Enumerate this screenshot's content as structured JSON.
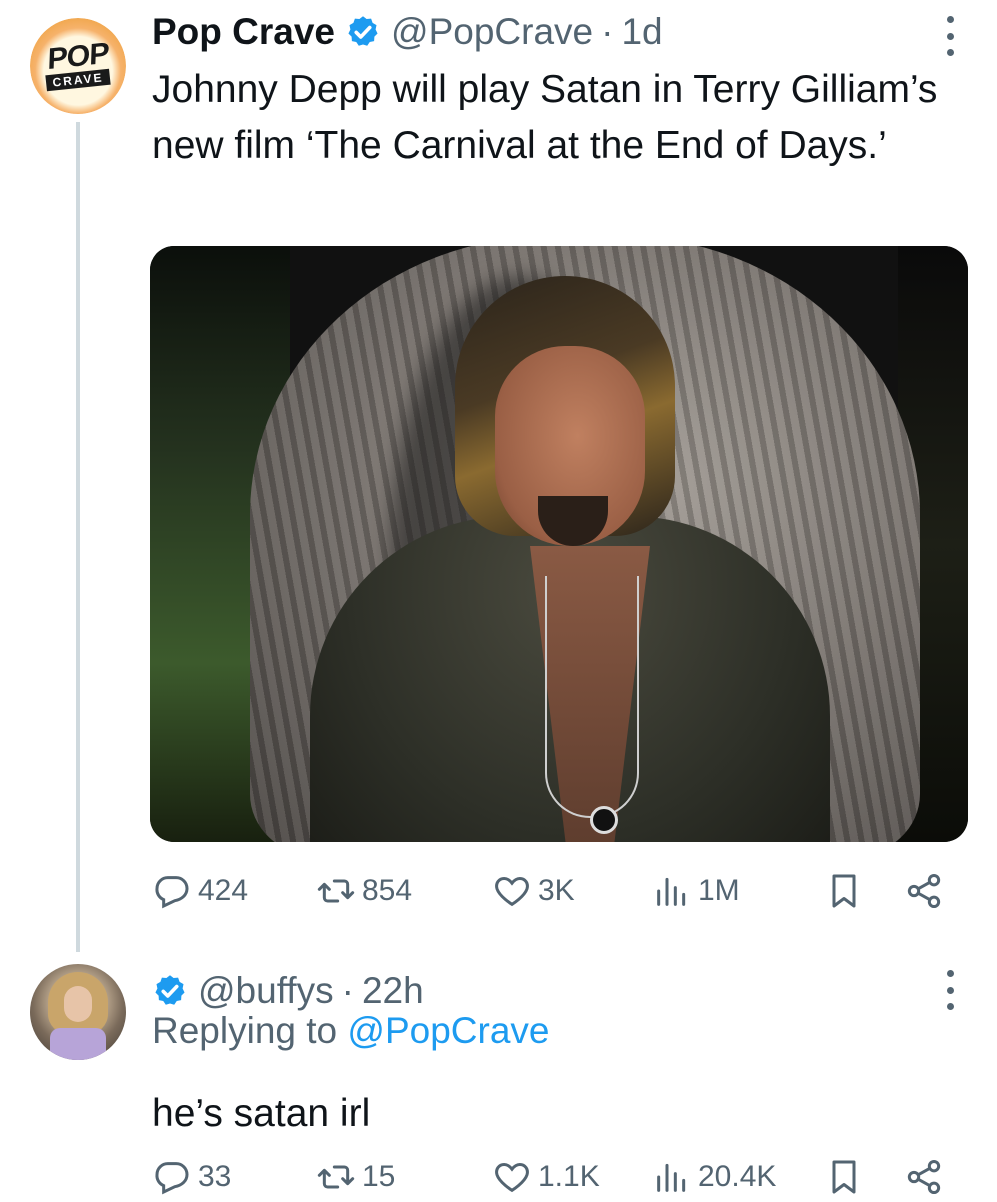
{
  "tweet": {
    "display_name": "Pop Crave",
    "handle": "@PopCrave",
    "separator": "·",
    "time": "1d",
    "text": "Johnny Depp will play Satan in Terry Gilliam’s new film ‘The Carnival at the End of Days.’",
    "avatar_logo_top": "POP",
    "avatar_logo_bottom": "CRAVE",
    "media_icon": "photo-of-johnny-depp",
    "stats": {
      "replies": "424",
      "retweets": "854",
      "likes": "3K",
      "views": "1M"
    }
  },
  "reply": {
    "handle": "@buffys",
    "separator": "·",
    "time": "22h",
    "replying_prefix": "Replying to ",
    "replying_to": "@PopCrave",
    "text": "he’s satan irl",
    "stats": {
      "replies": "33",
      "retweets": "15",
      "likes": "1.1K",
      "views": "20.4K"
    }
  },
  "colors": {
    "text_primary": "#0f1419",
    "text_secondary": "#536471",
    "accent": "#1d9bf0",
    "thread_line": "#cfd9de"
  },
  "icons": [
    "verified-badge-icon",
    "more-dots-icon",
    "reply-icon",
    "retweet-icon",
    "like-icon",
    "views-icon",
    "bookmark-icon",
    "share-icon"
  ]
}
